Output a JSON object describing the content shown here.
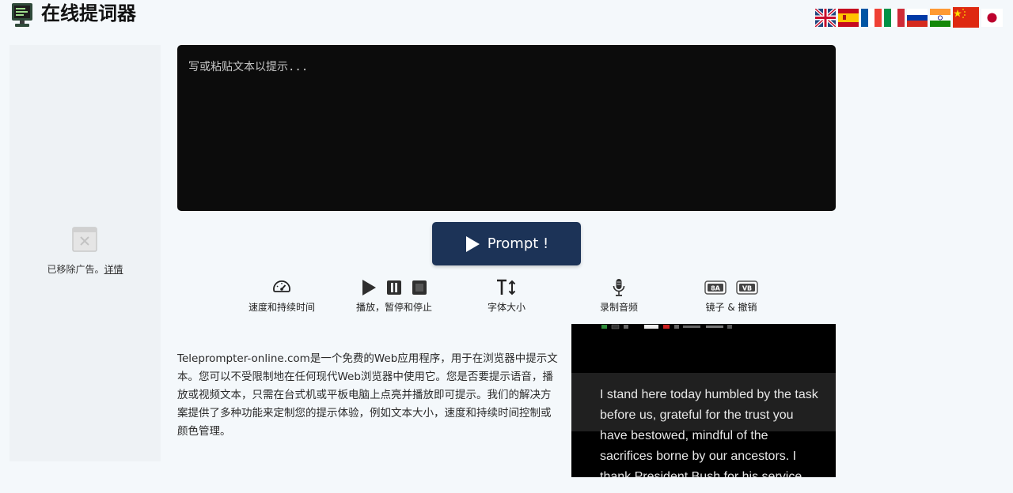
{
  "header": {
    "title": "在线提词器",
    "languages": [
      "English",
      "Español",
      "Français",
      "Italiano",
      "Русский",
      "हिन्दी",
      "中文",
      "日本語"
    ]
  },
  "ad": {
    "removed_text": "已移除广告。",
    "details_link": "详情"
  },
  "editor": {
    "placeholder": "写或粘贴文本以提示..."
  },
  "prompt_button": {
    "label": "Prompt !"
  },
  "tools": {
    "speed": "速度和持续时间",
    "playback": "播放，暂停和停止",
    "font_size": "字体大小",
    "record": "录制音频",
    "mirror": "镜子 & 撤销"
  },
  "description": "Teleprompter-online.com是一个免费的Web应用程序，用于在浏览器中提示文本。您可以不受限制地在任何现代Web浏览器中使用它。您是否要提示语音，播放或视频文本，只需在台式机或平板电脑上点亮并播放即可提示。我们的解决方案提供了多种功能来定制您的提示体验，例如文本大小，速度和持续时间控制或颜色管理。",
  "preview": {
    "text": "I stand here today humbled by the task before us, grateful for the trust you have bestowed, mindful of the sacrifices borne by our ancestors. I thank President Bush for his service"
  },
  "colors": {
    "button_bg": "#1c3357",
    "editor_bg": "#0c0c0c",
    "page_bg": "#f4f8fb"
  }
}
